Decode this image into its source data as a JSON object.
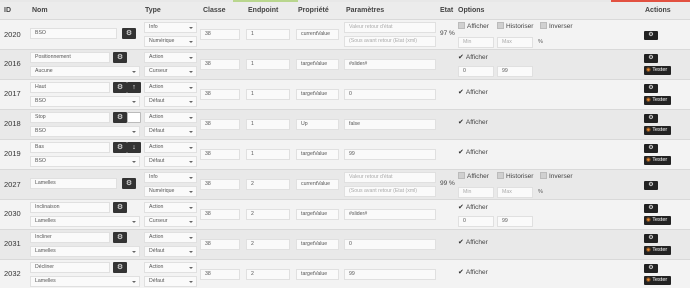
{
  "header": {
    "id": "ID",
    "nom": "Nom",
    "type": "Type",
    "classe": "Classe",
    "endpoint": "Endpoint",
    "propriete": "Propriété",
    "parametres": "Paramètres",
    "etat": "Etat",
    "options": "Options",
    "actions": "Actions"
  },
  "labels": {
    "afficher": "Afficher",
    "historiser": "Historiser",
    "inverser": "Inverser",
    "min": "Min",
    "max": "Max",
    "percent": "%",
    "tester": "Tester"
  },
  "colors": {
    "accent": "#222222",
    "rss": "#f08a2b",
    "top_green": "#b9d68e",
    "top_red": "#e25141"
  },
  "rows": [
    {
      "id": "2020",
      "name": "BSO",
      "type1": "Info",
      "type2": "Numérique",
      "classe": "38",
      "endpoint": "1",
      "prop": "currentValue",
      "param1": "Valeur retour d'état",
      "param2": "(Sous avant retour (Etat (xml)",
      "etat": "97 %"
    },
    {
      "id": "2016",
      "name": "Positionnement",
      "name2": "Aucune",
      "type1": "Action",
      "type2": "Curseur",
      "classe": "38",
      "endpoint": "1",
      "prop": "targetValue",
      "param1": "#slider#",
      "minv": "0",
      "maxv": "99"
    },
    {
      "id": "2017",
      "name": "Haut",
      "name2": "BSO",
      "type1": "Action",
      "type2": "Défaut",
      "classe": "38",
      "endpoint": "1",
      "prop": "targetValue",
      "param1": "0"
    },
    {
      "id": "2018",
      "name": "Stop",
      "name2": "BSO",
      "type1": "Action",
      "type2": "Défaut",
      "classe": "38",
      "endpoint": "1",
      "prop": "Up",
      "param1": "false"
    },
    {
      "id": "2019",
      "name": "Bas",
      "name2": "BSO",
      "type1": "Action",
      "type2": "Défaut",
      "classe": "38",
      "endpoint": "1",
      "prop": "targetValue",
      "param1": "99"
    },
    {
      "id": "2027",
      "name": "Lamelles",
      "type1": "Info",
      "type2": "Numérique",
      "classe": "38",
      "endpoint": "2",
      "prop": "currentValue",
      "param1": "Valeur retour d'état",
      "param2": "(Sous avant retour (Etat (xml)",
      "etat": "99 %"
    },
    {
      "id": "2030",
      "name": "Inclinaison",
      "name2": "Lamelles",
      "type1": "Action",
      "type2": "Curseur",
      "classe": "38",
      "endpoint": "2",
      "prop": "targetValue",
      "param1": "#slider#",
      "minv": "0",
      "maxv": "99"
    },
    {
      "id": "2031",
      "name": "Incliner",
      "name2": "Lamelles",
      "type1": "Action",
      "type2": "Défaut",
      "classe": "38",
      "endpoint": "2",
      "prop": "targetValue",
      "param1": "0"
    },
    {
      "id": "2032",
      "name": "Décliner",
      "name2": "Lamelles",
      "type1": "Action",
      "type2": "Défaut",
      "classe": "38",
      "endpoint": "2",
      "prop": "targetValue",
      "param1": "99"
    }
  ]
}
